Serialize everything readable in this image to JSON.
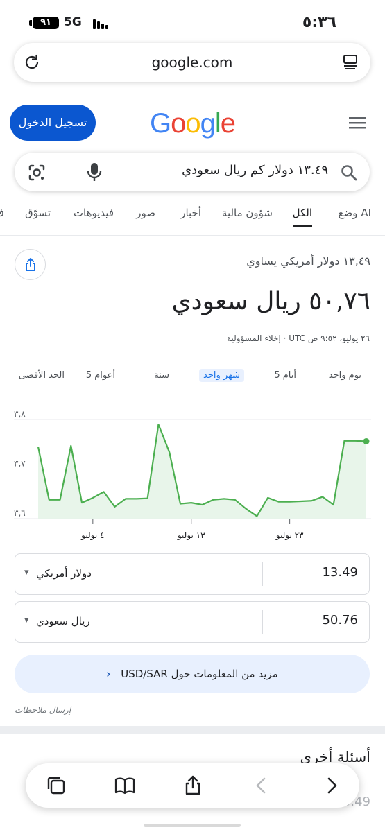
{
  "status_bar": {
    "battery": "٩١",
    "network": "5G",
    "time": "٥:٣٦"
  },
  "browser": {
    "url": "google.com"
  },
  "header": {
    "sign_in": "تسجيل الدخول",
    "logo": [
      "G",
      "o",
      "o",
      "g",
      "l",
      "e"
    ]
  },
  "search": {
    "query": "١٣.٤٩ دولار كم ريال سعودي"
  },
  "tabs": [
    "وضع AI",
    "الكل",
    "شؤون مالية",
    "أخبار",
    "صور",
    "فيديوهات",
    "تسوّق",
    "ف"
  ],
  "active_tab": "الكل",
  "converter": {
    "from_text": "١٣,٤٩ دولار أمريكي يساوي",
    "to_text": "٥٠,٧٦ ريال سعودي",
    "date_text": "٢٦ يوليو، ٩:٥٢ ص UTC · إخلاء المسؤولية",
    "ranges": [
      "يوم واحد",
      "5 أيام",
      "شهر واحد",
      "سنة",
      "5 أعوام",
      "الحد الأقصى"
    ],
    "active_range": "شهر واحد",
    "from_amount": "13.49",
    "from_currency": "دولار أمريكي",
    "to_amount": "50.76",
    "to_currency": "ريال سعودي",
    "more_info": "مزيد من المعلومات حول USD/SAR",
    "feedback": "إرسال ملاحظات"
  },
  "chart_data": {
    "type": "area",
    "y_ticks": [
      "٣,٨",
      "٣,٧",
      "٣,٦"
    ],
    "y_tick_values": [
      3.8,
      3.7,
      3.6
    ],
    "x_tick_labels": [
      "٤ يوليو",
      "١٣ يوليو",
      "٢٣ يوليو"
    ],
    "x_tick_index": [
      5,
      14,
      23
    ],
    "ylim": [
      3.6,
      3.8
    ],
    "values": [
      3.745,
      3.638,
      3.638,
      3.747,
      3.632,
      3.642,
      3.654,
      3.624,
      3.64,
      3.64,
      3.641,
      3.79,
      3.734,
      3.63,
      3.632,
      3.628,
      3.638,
      3.64,
      3.638,
      3.62,
      3.605,
      3.642,
      3.634,
      3.634,
      3.635,
      3.636,
      3.644,
      3.628,
      3.757,
      3.757,
      3.756
    ],
    "line_color": "#4caf50",
    "fill_color": "#e6f4e8",
    "grid": true
  },
  "other_questions": {
    "title": "أسئلة أخرى",
    "faded_value": "13.49"
  },
  "icons": [
    "reload-icon",
    "reader-icon",
    "menu-icon",
    "google-lens-icon",
    "mic-icon",
    "search-icon",
    "share-icon",
    "tabs-icon",
    "bookmarks-icon",
    "share-sheet-icon",
    "back-icon",
    "forward-icon"
  ]
}
